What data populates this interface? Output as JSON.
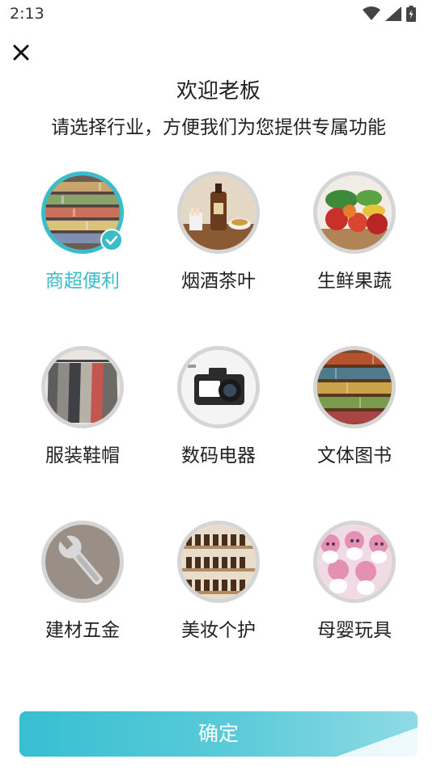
{
  "status_bar": {
    "time": "2:13",
    "icons": [
      "wifi-icon",
      "signal-icon",
      "battery-icon"
    ]
  },
  "header": {
    "close_icon": "close-icon",
    "title": "欢迎老板",
    "subtitle": "请选择行业，方便我们为您提供专属功能"
  },
  "industries": [
    {
      "label": "商超便利",
      "selected": true,
      "image": "supermarket-shelves"
    },
    {
      "label": "烟酒茶叶",
      "selected": false,
      "image": "tobacco-liquor-tea"
    },
    {
      "label": "生鲜果蔬",
      "selected": false,
      "image": "fresh-fruit-vegetables"
    },
    {
      "label": "服装鞋帽",
      "selected": false,
      "image": "clothing-rack"
    },
    {
      "label": "数码电器",
      "selected": false,
      "image": "digital-camera"
    },
    {
      "label": "文体图书",
      "selected": false,
      "image": "bookshelves"
    },
    {
      "label": "建材五金",
      "selected": false,
      "image": "wrench"
    },
    {
      "label": "美妆个护",
      "selected": false,
      "image": "cosmetic-bottles"
    },
    {
      "label": "母婴玩具",
      "selected": false,
      "image": "plush-toys"
    }
  ],
  "footer": {
    "confirm_label": "确定"
  },
  "colors": {
    "accent": "#3bbcc9",
    "button_start": "#36bfd2",
    "button_end": "#8edbe5",
    "ring": "#d5d5d5",
    "text": "#222222"
  }
}
